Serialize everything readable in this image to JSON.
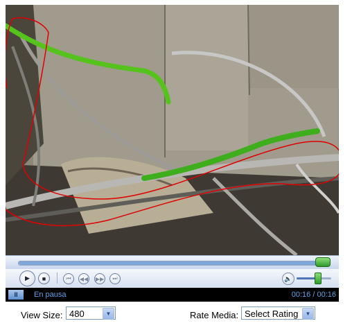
{
  "player": {
    "status_text": "En pausa",
    "pause_glyph": "II",
    "time": "00:16 / 00:16",
    "seek_fraction": 1.0,
    "volume_fraction": 0.6
  },
  "footer": {
    "view_size_label": "View Size:",
    "view_size_value": "480",
    "rate_label": "Rate Media:",
    "rate_value": "Select Rating"
  },
  "colors": {
    "accent_green": "#2f9a2a",
    "status_blue": "#5ea2e8",
    "annotation_red": "#e00000"
  }
}
